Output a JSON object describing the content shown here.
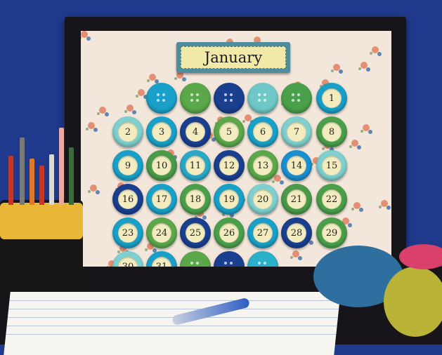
{
  "calendar": {
    "month": "January",
    "rows": [
      [
        {
          "n": "",
          "c": "#1aa0c8"
        },
        {
          "n": "",
          "c": "#5aa84a"
        },
        {
          "n": "",
          "c": "#1a3f8f"
        },
        {
          "n": "",
          "c": "#6fc7c7"
        },
        {
          "n": "",
          "c": "#4aa04a"
        },
        {
          "n": "1",
          "c": "#1aa0c8"
        }
      ],
      [
        {
          "n": "2",
          "c": "#7fd0cf"
        },
        {
          "n": "3",
          "c": "#1aa0c8"
        },
        {
          "n": "4",
          "c": "#1a3f8f"
        },
        {
          "n": "5",
          "c": "#5aa84a"
        },
        {
          "n": "6",
          "c": "#1aa0c8"
        },
        {
          "n": "7",
          "c": "#7fd0cf"
        },
        {
          "n": "8",
          "c": "#4aa04a"
        }
      ],
      [
        {
          "n": "9",
          "c": "#1aa0c8"
        },
        {
          "n": "10",
          "c": "#4a9a4a"
        },
        {
          "n": "11",
          "c": "#2aa8c8"
        },
        {
          "n": "12",
          "c": "#1a3f8f"
        },
        {
          "n": "13",
          "c": "#5aa84a"
        },
        {
          "n": "14",
          "c": "#1a8fd0"
        },
        {
          "n": "15",
          "c": "#7fd0cf"
        }
      ],
      [
        {
          "n": "16",
          "c": "#1a3f8f"
        },
        {
          "n": "17",
          "c": "#1aa0c8"
        },
        {
          "n": "18",
          "c": "#4aa04a"
        },
        {
          "n": "19",
          "c": "#1aa0c8"
        },
        {
          "n": "20",
          "c": "#7fd0cf"
        },
        {
          "n": "21",
          "c": "#4a9a4a"
        },
        {
          "n": "22",
          "c": "#4aa04a"
        }
      ],
      [
        {
          "n": "23",
          "c": "#1aa0c8"
        },
        {
          "n": "24",
          "c": "#5aa84a"
        },
        {
          "n": "25",
          "c": "#1a3f8f"
        },
        {
          "n": "26",
          "c": "#4aa04a"
        },
        {
          "n": "27",
          "c": "#1aa0c8"
        },
        {
          "n": "28",
          "c": "#1a3f8f"
        },
        {
          "n": "29",
          "c": "#4aa04a"
        }
      ],
      [
        {
          "n": "30",
          "c": "#7fd0cf"
        },
        {
          "n": "31",
          "c": "#1aa0c8"
        },
        {
          "n": "",
          "c": "#5aa84a"
        },
        {
          "n": "",
          "c": "#1a3f8f"
        },
        {
          "n": "",
          "c": "#2ab0c8"
        }
      ]
    ]
  },
  "colors": {
    "wall": "#1f3a8c",
    "frame": "#15151a",
    "fabric": "#f3e6da",
    "label_border": "#4d8d9d",
    "label_fill": "#f0e9a8",
    "pen": "#2f5ec2",
    "bowl_blue": "#2f6fa0",
    "bowl_green": "#b9b338",
    "bowl_pink": "#d9406a"
  }
}
